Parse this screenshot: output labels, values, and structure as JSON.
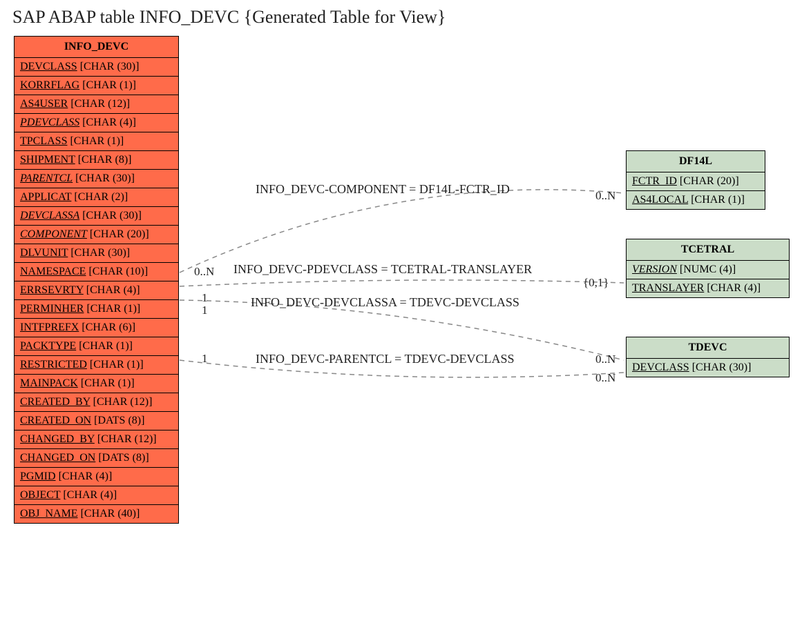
{
  "title": "SAP ABAP table INFO_DEVC {Generated Table for View}",
  "main_table": {
    "name": "INFO_DEVC",
    "fields": [
      {
        "name": "DEVCLASS",
        "type": "[CHAR (30)]",
        "italic": false
      },
      {
        "name": "KORRFLAG",
        "type": "[CHAR (1)]",
        "italic": false
      },
      {
        "name": "AS4USER",
        "type": "[CHAR (12)]",
        "italic": false
      },
      {
        "name": "PDEVCLASS",
        "type": "[CHAR (4)]",
        "italic": true
      },
      {
        "name": "TPCLASS",
        "type": "[CHAR (1)]",
        "italic": false
      },
      {
        "name": "SHIPMENT",
        "type": "[CHAR (8)]",
        "italic": false
      },
      {
        "name": "PARENTCL",
        "type": "[CHAR (30)]",
        "italic": true
      },
      {
        "name": "APPLICAT",
        "type": "[CHAR (2)]",
        "italic": false
      },
      {
        "name": "DEVCLASSA",
        "type": "[CHAR (30)]",
        "italic": true
      },
      {
        "name": "COMPONENT",
        "type": "[CHAR (20)]",
        "italic": true
      },
      {
        "name": "DLVUNIT",
        "type": "[CHAR (30)]",
        "italic": false
      },
      {
        "name": "NAMESPACE",
        "type": "[CHAR (10)]",
        "italic": false
      },
      {
        "name": "ERRSEVRTY",
        "type": "[CHAR (4)]",
        "italic": false
      },
      {
        "name": "PERMINHER",
        "type": "[CHAR (1)]",
        "italic": false
      },
      {
        "name": "INTFPREFX",
        "type": "[CHAR (6)]",
        "italic": false
      },
      {
        "name": "PACKTYPE",
        "type": "[CHAR (1)]",
        "italic": false
      },
      {
        "name": "RESTRICTED",
        "type": "[CHAR (1)]",
        "italic": false
      },
      {
        "name": "MAINPACK",
        "type": "[CHAR (1)]",
        "italic": false
      },
      {
        "name": "CREATED_BY",
        "type": "[CHAR (12)]",
        "italic": false
      },
      {
        "name": "CREATED_ON",
        "type": "[DATS (8)]",
        "italic": false
      },
      {
        "name": "CHANGED_BY",
        "type": "[CHAR (12)]",
        "italic": false
      },
      {
        "name": "CHANGED_ON",
        "type": "[DATS (8)]",
        "italic": false
      },
      {
        "name": "PGMID",
        "type": "[CHAR (4)]",
        "italic": false
      },
      {
        "name": "OBJECT",
        "type": "[CHAR (4)]",
        "italic": false
      },
      {
        "name": "OBJ_NAME",
        "type": "[CHAR (40)]",
        "italic": false
      }
    ]
  },
  "related_tables": [
    {
      "name": "DF14L",
      "fields": [
        {
          "name": "FCTR_ID",
          "type": "[CHAR (20)]",
          "italic": false
        },
        {
          "name": "AS4LOCAL",
          "type": "[CHAR (1)]",
          "italic": false
        }
      ]
    },
    {
      "name": "TCETRAL",
      "fields": [
        {
          "name": "VERSION",
          "type": "[NUMC (4)]",
          "italic": true
        },
        {
          "name": "TRANSLAYER",
          "type": "[CHAR (4)]",
          "italic": false
        }
      ]
    },
    {
      "name": "TDEVC",
      "fields": [
        {
          "name": "DEVCLASS",
          "type": "[CHAR (30)]",
          "italic": false
        }
      ]
    }
  ],
  "relations": [
    {
      "label": "INFO_DEVC-COMPONENT = DF14L-FCTR_ID",
      "left_card": "0..N",
      "right_card": "0..N"
    },
    {
      "label": "INFO_DEVC-PDEVCLASS = TCETRAL-TRANSLAYER",
      "left_card": "",
      "right_card": "{0,1}"
    },
    {
      "label": "INFO_DEVC-DEVCLASSA = TDEVC-DEVCLASS",
      "left_card": "1",
      "right_card": ""
    },
    {
      "label": "INFO_DEVC-PARENTCL = TDEVC-DEVCLASS",
      "left_card": "1",
      "right_card": "0..N"
    }
  ],
  "extra_cards": {
    "left_1": "1",
    "left_1b": "1",
    "right_0n_2": "0..N"
  }
}
